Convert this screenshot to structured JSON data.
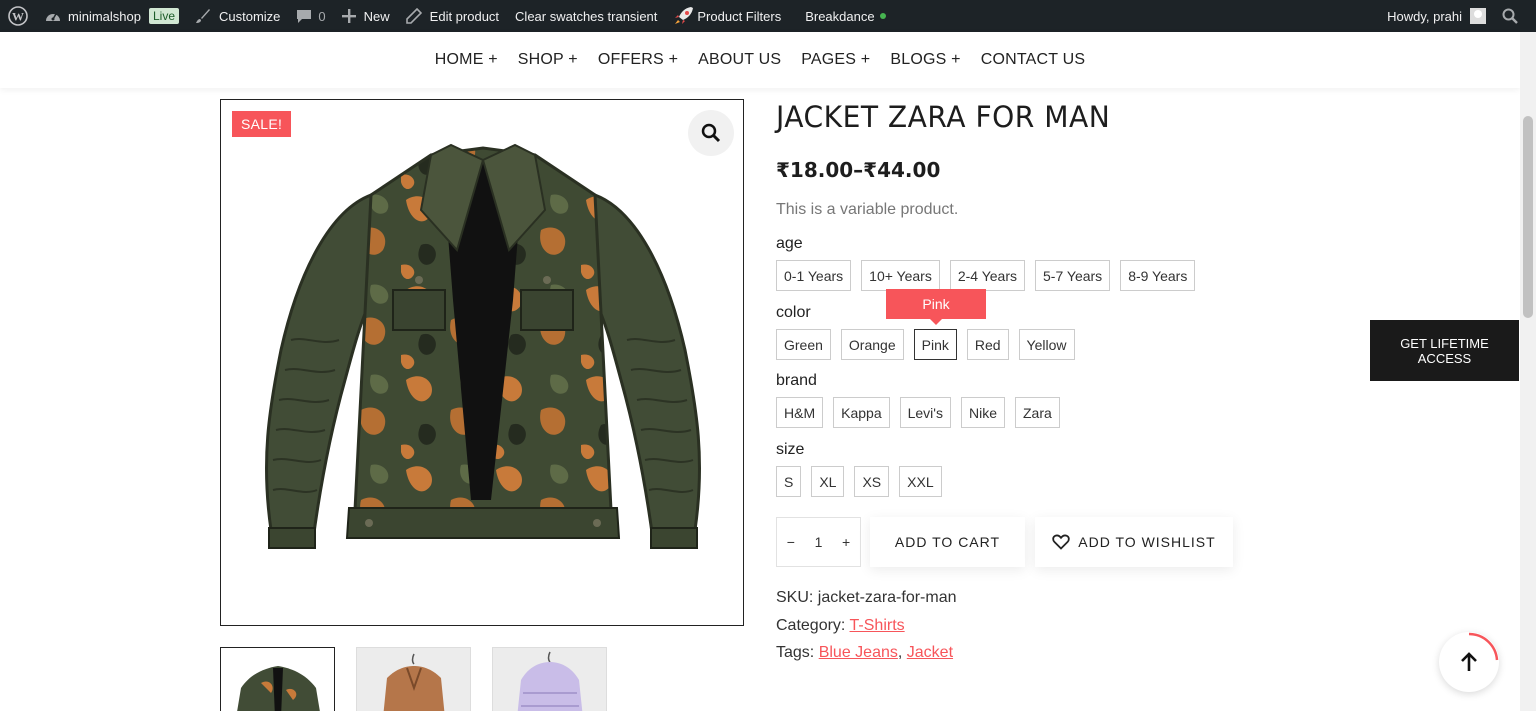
{
  "adminbar": {
    "site_name": "minimalshop",
    "live_badge": "Live",
    "customize": "Customize",
    "comments_count": "0",
    "new": "New",
    "edit_product": "Edit product",
    "clear_swatches": "Clear swatches transient",
    "product_filters": "Product Filters",
    "breakdance": "Breakdance",
    "howdy": "Howdy, prahi"
  },
  "nav": {
    "items": [
      "HOME +",
      "SHOP +",
      "OFFERS +",
      "ABOUT US",
      "PAGES +",
      "BLOGS +",
      "CONTACT US"
    ]
  },
  "product": {
    "sale_badge": "SALE!",
    "title": "JACKET ZARA FOR MAN",
    "price": "₹18.00–₹44.00",
    "description": "This is a variable product.",
    "attributes": [
      {
        "label": "age",
        "options": [
          "0-1 Years",
          "10+ Years",
          "2-4 Years",
          "5-7 Years",
          "8-9 Years"
        ]
      },
      {
        "label": "color",
        "options": [
          "Green",
          "Orange",
          "Pink",
          "Red",
          "Yellow"
        ],
        "selected": "Pink"
      },
      {
        "label": "brand",
        "options": [
          "H&M",
          "Kappa",
          "Levi's",
          "Nike",
          "Zara"
        ]
      },
      {
        "label": "size",
        "options": [
          "S",
          "XL",
          "XS",
          "XXL"
        ]
      }
    ],
    "tooltip": "Pink",
    "quantity": "1",
    "qty_minus": "−",
    "qty_plus": "+",
    "add_to_cart": "ADD TO CART",
    "add_to_wishlist": "ADD TO WISHLIST",
    "sku_label": "SKU:",
    "sku": "jacket-zara-for-man",
    "category_label": "Category:",
    "category": "T-Shirts",
    "tags_label": "Tags:",
    "tags": [
      "Blue Jeans",
      "Jacket"
    ],
    "tag_separator": ","
  },
  "lifetime_button": "GET LIFETIME ACCESS",
  "colors": {
    "accent": "#f7555a",
    "adminbar": "#1d2327",
    "dark_button": "#1a1a1a"
  }
}
